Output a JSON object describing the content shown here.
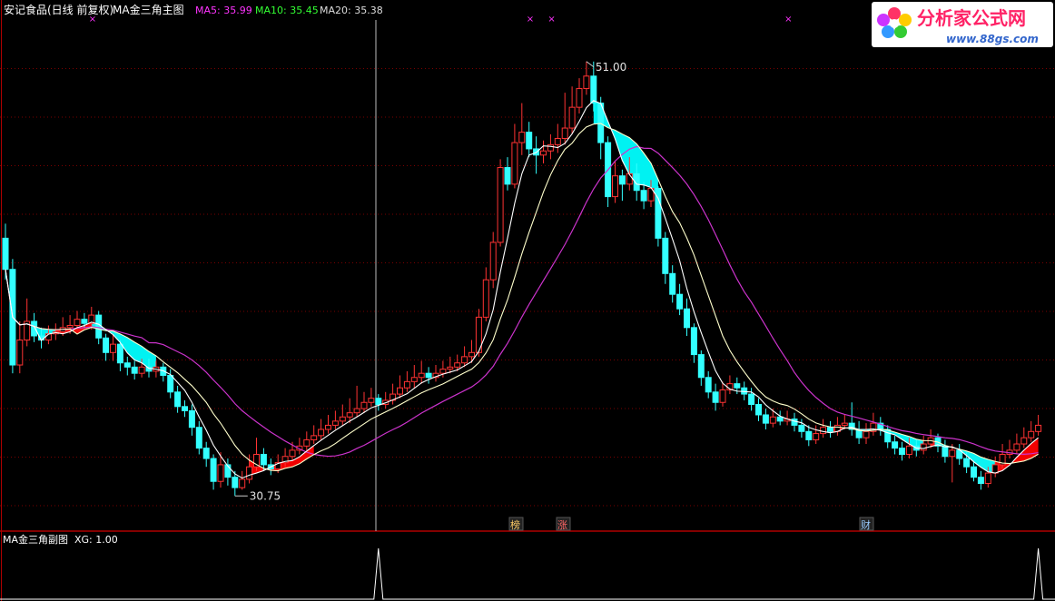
{
  "header": {
    "stock_name": "安记食品(日线 前复权)",
    "main_indicator": "MA金三角主图",
    "ma5": {
      "label": "MA5: 35.99",
      "color": "#ff33ff"
    },
    "ma10": {
      "label": "MA10: 35.45",
      "color": "#33ff33"
    },
    "ma20": {
      "label": "MA20: 35.38",
      "color": "#dddddd"
    }
  },
  "watermark": {
    "brand": "分析家公式网",
    "url": "www.88gs.com"
  },
  "sub_panel": {
    "label": "MA金三角副图",
    "xg": "XG: 1.00"
  },
  "annotations": {
    "high_label": "51.00",
    "low_label": "30.75"
  },
  "badges": [
    {
      "text": "榜",
      "color": "#ffcc66"
    },
    {
      "text": "涨",
      "color": "#ff6666"
    },
    {
      "text": "财",
      "color": "#99ccff"
    }
  ],
  "colors": {
    "background": "#000000",
    "up_candle": "#ff3333",
    "down_candle": "#33ffff",
    "ma5_line": "#ffffff",
    "ma10_line": "#ffffcc",
    "ma20_line": "#cc33cc",
    "panel_border": "#b00000",
    "golden_triangle": "#ff0000",
    "death_triangle": "#00ffff",
    "marker": "#ff33ff"
  },
  "chart_data": {
    "type": "candlestick",
    "ylim": [
      29.5,
      53
    ],
    "high_value": 51.0,
    "low_value": 30.75,
    "candles": [
      [
        42.5,
        41.0,
        43.2,
        40.5
      ],
      [
        41.0,
        36.4,
        41.5,
        36.0
      ],
      [
        36.4,
        37.6,
        38.5,
        36.0
      ],
      [
        37.6,
        38.5,
        39.6,
        37.3
      ],
      [
        38.5,
        37.8,
        38.9,
        37.5
      ],
      [
        37.8,
        37.6,
        38.2,
        37.2
      ],
      [
        37.6,
        37.9,
        38.3,
        37.4
      ],
      [
        37.9,
        38.0,
        38.4,
        37.6
      ],
      [
        38.0,
        38.2,
        38.7,
        37.8
      ],
      [
        38.2,
        38.3,
        38.8,
        37.9
      ],
      [
        38.3,
        38.6,
        39.0,
        38.1
      ],
      [
        38.6,
        38.4,
        38.9,
        38.2
      ],
      [
        38.4,
        38.8,
        39.2,
        38.1
      ],
      [
        38.8,
        37.7,
        39.0,
        37.4
      ],
      [
        37.7,
        37.0,
        37.9,
        36.6
      ],
      [
        37.0,
        37.4,
        37.9,
        36.6
      ],
      [
        37.4,
        36.5,
        37.6,
        36.1
      ],
      [
        36.5,
        36.3,
        36.8,
        35.9
      ],
      [
        36.3,
        36.0,
        36.6,
        35.7
      ],
      [
        36.0,
        36.3,
        36.7,
        35.8
      ],
      [
        36.3,
        36.1,
        36.7,
        35.8
      ],
      [
        36.1,
        36.3,
        36.6,
        35.8
      ],
      [
        36.3,
        35.9,
        36.5,
        35.6
      ],
      [
        35.9,
        35.1,
        36.2,
        34.8
      ],
      [
        35.1,
        34.4,
        35.4,
        34.1
      ],
      [
        34.4,
        34.2,
        34.7,
        33.9
      ],
      [
        34.2,
        33.4,
        34.5,
        33.0
      ],
      [
        33.4,
        32.4,
        33.7,
        32.1
      ],
      [
        32.4,
        31.9,
        32.7,
        31.5
      ],
      [
        31.9,
        30.8,
        32.1,
        30.4
      ],
      [
        30.8,
        31.6,
        32.2,
        30.5
      ],
      [
        31.6,
        31.0,
        31.9,
        30.6
      ],
      [
        31.0,
        30.5,
        31.3,
        30.1
      ],
      [
        30.5,
        30.9,
        31.3,
        30.4
      ],
      [
        30.9,
        31.5,
        32.1,
        30.7
      ],
      [
        31.5,
        32.1,
        32.9,
        31.3
      ],
      [
        32.1,
        31.6,
        32.4,
        31.3
      ],
      [
        31.6,
        31.4,
        31.9,
        31.1
      ],
      [
        31.4,
        31.7,
        32.1,
        31.2
      ],
      [
        31.7,
        32.0,
        32.4,
        31.5
      ],
      [
        32.0,
        32.3,
        32.7,
        31.8
      ],
      [
        32.3,
        32.5,
        32.9,
        32.1
      ],
      [
        32.5,
        32.8,
        33.2,
        32.3
      ],
      [
        32.8,
        33.0,
        33.5,
        32.6
      ],
      [
        33.0,
        33.3,
        33.8,
        32.8
      ],
      [
        33.3,
        33.5,
        34.0,
        33.1
      ],
      [
        33.5,
        33.7,
        34.2,
        33.3
      ],
      [
        33.7,
        33.9,
        34.5,
        33.5
      ],
      [
        33.9,
        34.1,
        34.8,
        33.6
      ],
      [
        34.1,
        34.3,
        35.4,
        33.9
      ],
      [
        34.3,
        34.6,
        35.1,
        34.1
      ],
      [
        34.6,
        34.8,
        35.3,
        34.4
      ],
      [
        34.8,
        34.5,
        35.0,
        34.2
      ],
      [
        34.5,
        34.7,
        35.1,
        34.3
      ],
      [
        34.7,
        35.0,
        35.5,
        34.5
      ],
      [
        35.0,
        35.3,
        35.9,
        34.8
      ],
      [
        35.3,
        35.6,
        36.1,
        35.1
      ],
      [
        35.6,
        35.8,
        36.4,
        35.3
      ],
      [
        35.8,
        36.0,
        36.6,
        35.5
      ],
      [
        36.0,
        35.8,
        36.3,
        35.5
      ],
      [
        35.8,
        36.0,
        36.4,
        35.6
      ],
      [
        36.0,
        36.2,
        36.6,
        35.8
      ],
      [
        36.2,
        36.3,
        36.8,
        36.0
      ],
      [
        36.3,
        36.5,
        36.9,
        36.1
      ],
      [
        36.5,
        36.8,
        37.3,
        36.3
      ],
      [
        36.8,
        37.0,
        37.6,
        36.5
      ],
      [
        37.0,
        38.7,
        39.1,
        36.8
      ],
      [
        38.7,
        40.5,
        41.1,
        38.5
      ],
      [
        40.5,
        42.3,
        42.8,
        40.1
      ],
      [
        42.3,
        45.9,
        46.3,
        42.1
      ],
      [
        45.9,
        45.1,
        46.4,
        44.8
      ],
      [
        45.1,
        47.1,
        48.0,
        44.9
      ],
      [
        47.1,
        47.6,
        49.0,
        46.5
      ],
      [
        47.6,
        46.8,
        48.1,
        46.4
      ],
      [
        46.8,
        46.5,
        47.4,
        45.6
      ],
      [
        46.5,
        46.7,
        47.2,
        46.1
      ],
      [
        46.7,
        47.0,
        47.5,
        46.3
      ],
      [
        47.0,
        47.3,
        48.0,
        46.6
      ],
      [
        47.3,
        47.8,
        49.5,
        47.0
      ],
      [
        47.8,
        48.8,
        49.8,
        47.5
      ],
      [
        48.8,
        49.7,
        50.2,
        48.5
      ],
      [
        49.7,
        50.3,
        51.0,
        49.4
      ],
      [
        50.3,
        49.0,
        51.0,
        48.6
      ],
      [
        49.0,
        47.1,
        49.3,
        46.3
      ],
      [
        47.1,
        44.5,
        47.4,
        44.0
      ],
      [
        44.5,
        45.5,
        46.2,
        44.2
      ],
      [
        45.5,
        45.1,
        45.8,
        44.3
      ],
      [
        45.1,
        45.6,
        46.4,
        44.8
      ],
      [
        45.6,
        44.8,
        46.1,
        44.3
      ],
      [
        44.8,
        44.3,
        45.2,
        43.9
      ],
      [
        44.3,
        44.9,
        45.3,
        44.0
      ],
      [
        44.9,
        42.5,
        45.0,
        42.1
      ],
      [
        42.5,
        40.8,
        42.8,
        40.3
      ],
      [
        40.8,
        39.8,
        41.2,
        39.4
      ],
      [
        39.8,
        39.1,
        40.3,
        38.8
      ],
      [
        39.1,
        38.2,
        39.6,
        37.8
      ],
      [
        38.2,
        36.9,
        38.4,
        36.5
      ],
      [
        36.9,
        35.8,
        37.1,
        35.4
      ],
      [
        35.8,
        35.1,
        36.1,
        34.8
      ],
      [
        35.1,
        34.6,
        35.5,
        34.2
      ],
      [
        34.6,
        35.2,
        35.6,
        34.4
      ],
      [
        35.2,
        35.5,
        35.9,
        35.0
      ],
      [
        35.5,
        35.3,
        35.8,
        35.0
      ],
      [
        35.3,
        35.0,
        35.6,
        34.7
      ],
      [
        35.0,
        34.5,
        35.3,
        34.2
      ],
      [
        34.5,
        34.0,
        34.8,
        33.7
      ],
      [
        34.0,
        33.6,
        34.3,
        33.3
      ],
      [
        33.6,
        33.9,
        34.3,
        33.4
      ],
      [
        33.9,
        33.7,
        34.2,
        33.5
      ],
      [
        33.7,
        33.8,
        34.2,
        33.5
      ],
      [
        33.8,
        33.5,
        34.1,
        33.2
      ],
      [
        33.5,
        33.2,
        33.8,
        32.9
      ],
      [
        33.2,
        32.8,
        33.5,
        32.5
      ],
      [
        32.8,
        33.1,
        33.5,
        32.6
      ],
      [
        33.1,
        33.4,
        33.8,
        32.9
      ],
      [
        33.4,
        33.2,
        33.7,
        32.9
      ],
      [
        33.2,
        33.5,
        33.9,
        33.0
      ],
      [
        33.5,
        33.6,
        34.0,
        33.3
      ],
      [
        33.6,
        33.3,
        34.6,
        33.0
      ],
      [
        33.3,
        32.9,
        33.7,
        32.6
      ],
      [
        32.9,
        33.2,
        33.6,
        32.6
      ],
      [
        33.2,
        33.6,
        34.1,
        33.0
      ],
      [
        33.6,
        33.3,
        33.9,
        33.0
      ],
      [
        33.3,
        32.7,
        33.5,
        32.4
      ],
      [
        32.7,
        32.4,
        33.0,
        32.1
      ],
      [
        32.4,
        32.1,
        32.7,
        31.8
      ],
      [
        32.1,
        32.5,
        32.9,
        31.9
      ],
      [
        32.5,
        32.3,
        32.8,
        32.0
      ],
      [
        32.3,
        32.6,
        33.0,
        32.1
      ],
      [
        32.6,
        32.9,
        33.3,
        32.4
      ],
      [
        32.9,
        32.5,
        33.1,
        32.2
      ],
      [
        32.5,
        32.0,
        32.8,
        31.7
      ],
      [
        32.0,
        32.3,
        32.6,
        30.75
      ],
      [
        32.3,
        31.9,
        32.6,
        31.6
      ],
      [
        31.9,
        31.5,
        32.2,
        31.2
      ],
      [
        31.5,
        31.0,
        31.8,
        30.8
      ],
      [
        31.0,
        30.7,
        31.3,
        30.4
      ],
      [
        30.7,
        31.2,
        31.5,
        30.5
      ],
      [
        31.2,
        31.6,
        32.0,
        31.0
      ],
      [
        31.6,
        32.1,
        32.6,
        31.4
      ],
      [
        32.1,
        32.3,
        32.8,
        31.9
      ],
      [
        32.3,
        32.6,
        33.1,
        32.1
      ],
      [
        32.6,
        32.9,
        33.4,
        32.4
      ],
      [
        32.9,
        33.2,
        33.7,
        32.7
      ],
      [
        33.2,
        33.5,
        34.0,
        33.0
      ]
    ]
  }
}
